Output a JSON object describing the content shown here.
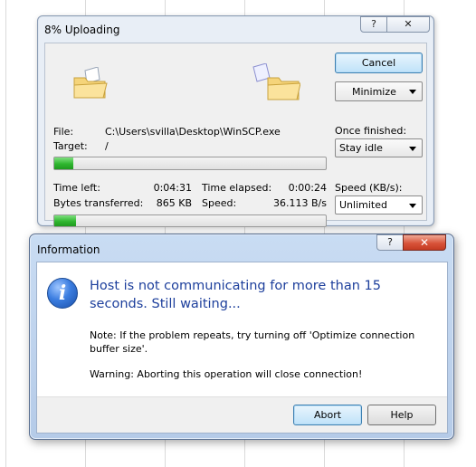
{
  "upload_window": {
    "title": "8% Uploading",
    "help_glyph": "?",
    "close_glyph": "✕",
    "file_label": "File:",
    "file_value": "C:\\Users\\svilla\\Desktop\\WinSCP.exe",
    "target_label": "Target:",
    "target_value": "/",
    "file_progress": 0.07,
    "time_left_label": "Time left:",
    "time_left_value": "0:04:31",
    "time_elapsed_label": "Time elapsed:",
    "time_elapsed_value": "0:00:24",
    "bytes_label": "Bytes transferred:",
    "bytes_value": "865 KB",
    "speed_label": "Speed:",
    "speed_value": "36.113 B/s",
    "total_progress": 0.08,
    "cancel_label": "Cancel",
    "minimize_label": "Minimize",
    "once_finished_label": "Once finished:",
    "once_finished_value": "Stay idle",
    "speed_limit_label": "Speed (KB/s):",
    "speed_limit_value": "Unlimited"
  },
  "info_dialog": {
    "title": "Information",
    "help_glyph": "?",
    "close_glyph": "✕",
    "icon_glyph": "i",
    "main_instruction": "Host is not communicating for more than 15 seconds. Still waiting...",
    "note": "Note: If the problem repeats, try turning off 'Optimize connection buffer size'.",
    "warning": "Warning: Aborting this operation will close connection!",
    "abort_label": "Abort",
    "help_label": "Help"
  },
  "colors": {
    "progress_fill": "#2fb62f",
    "main_instruction": "#1d3f9c",
    "close_button": "#c43a22"
  }
}
